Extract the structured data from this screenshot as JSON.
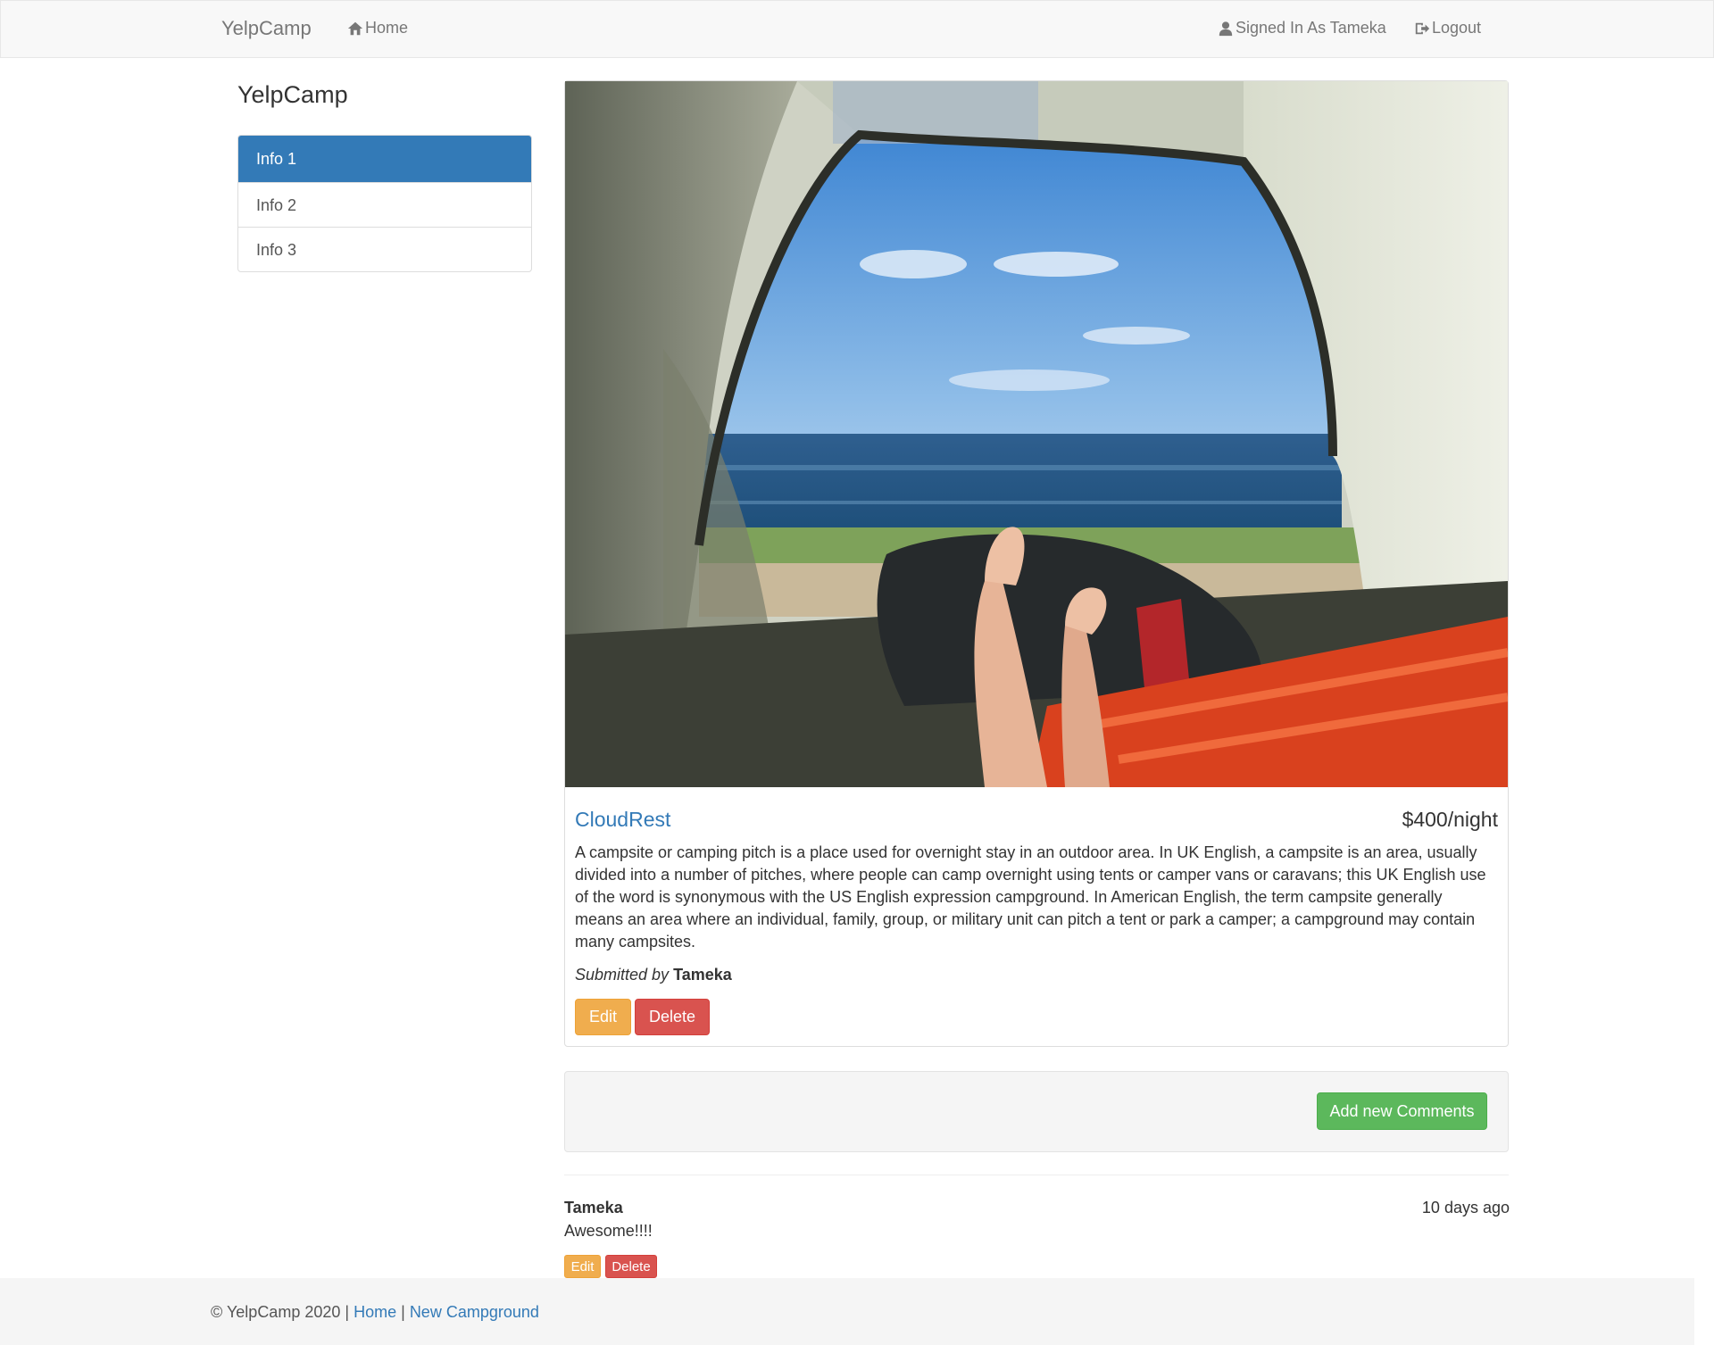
{
  "navbar": {
    "brand": "YelpCamp",
    "home_label": "Home",
    "user_label": "Signed In As Tameka",
    "logout_label": "Logout"
  },
  "sidebar": {
    "title": "YelpCamp",
    "items": [
      {
        "label": "Info 1",
        "active": true
      },
      {
        "label": "Info 2",
        "active": false
      },
      {
        "label": "Info 3",
        "active": false
      }
    ]
  },
  "campground": {
    "name": "CloudRest",
    "price": "$400/night",
    "description": "A campsite or camping pitch is a place used for overnight stay in an outdoor area. In UK English, a campsite is an area, usually divided into a number of pitches, where people can camp overnight using tents or camper vans or caravans; this UK English use of the word is synonymous with the US English expression campground. In American English, the term campsite generally means an area where an individual, family, group, or military unit can pitch a tent or park a camper; a campground may contain many campsites.",
    "submitted_prefix": "Submitted by",
    "author": "Tameka",
    "edit_label": "Edit",
    "delete_label": "Delete"
  },
  "comments": {
    "add_label": "Add new Comments",
    "items": [
      {
        "author": "Tameka",
        "time": "10 days ago",
        "text": "Awesome!!!!",
        "edit_label": "Edit",
        "delete_label": "Delete"
      }
    ]
  },
  "footer": {
    "copyright": "© YelpCamp 2020 |",
    "separator": "|",
    "home_link": "Home",
    "new_link": "New Campground"
  },
  "colors": {
    "primary": "#337ab7",
    "warning": "#f0ad4e",
    "danger": "#d9534f",
    "success": "#5cb85c"
  },
  "icons": {
    "home": "home-icon",
    "user": "user-icon",
    "logout": "logout-icon"
  }
}
